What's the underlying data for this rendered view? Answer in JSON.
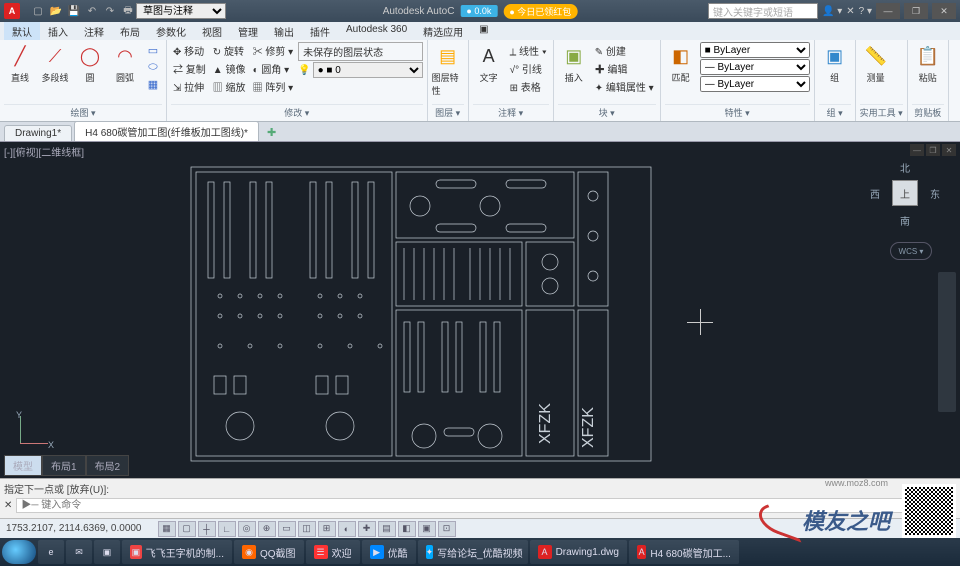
{
  "titlebar": {
    "app": "Autodesk AutoC",
    "workspace": "草图与注释",
    "badge1": "● 0.0k",
    "badge2": "● 今日已领红包",
    "search_placeholder": "键入关键字或短语",
    "minimize": "—",
    "maximize": "❐",
    "close": "✕",
    "logo": "A"
  },
  "menu": [
    "默认",
    "插入",
    "注释",
    "布局",
    "参数化",
    "视图",
    "管理",
    "输出",
    "插件",
    "Autodesk 360",
    "精选应用",
    "▣"
  ],
  "ribbon": {
    "draw": {
      "title": "绘图 ▾",
      "line": "直线",
      "pline": "多段线",
      "circle": "圆",
      "arc": "圆弧"
    },
    "modify": {
      "title": "修改 ▾",
      "items": [
        "✥ 移动",
        "↻ 旋转",
        "✂ 修剪 ▾",
        "⇄ 复制",
        "▲ 镜像",
        "◐ 圆角 ▾",
        "⇲ 拉伸",
        "▥ 缩放",
        "▦ 阵列 ▾"
      ],
      "restore": "未保存的图层状态"
    },
    "layer": {
      "title": "图层 ▾",
      "btn": "图层特性",
      "sel": "● ■ 0"
    },
    "annot": {
      "title": "注释 ▾",
      "text": "文字",
      "items": [
        "⟂ 线性 ▾",
        "√° 引线",
        "⊞ 表格"
      ]
    },
    "block": {
      "title": "块 ▾",
      "insert": "插入",
      "items": [
        "✎ 创建",
        "✚ 编辑",
        "✦ 编辑属性 ▾"
      ]
    },
    "prop": {
      "title": "特性 ▾",
      "color": "■ ByLayer",
      "lw": "— ByLayer",
      "lt": "— ByLayer",
      "match": "匹配"
    },
    "group": {
      "title": "组 ▾",
      "btn": "组"
    },
    "util": {
      "title": "实用工具 ▾",
      "btn": "测量",
      "paste": "粘贴"
    },
    "clip": {
      "title": "剪贴板",
      "btn": "粘贴"
    }
  },
  "doc_tabs": [
    "Drawing1*",
    "H4 680碳管加工图(纤维板加工图线)*"
  ],
  "canvas": {
    "view": "[-][俯视][二维线框]",
    "cube": "上",
    "dirs": {
      "n": "北",
      "s": "南",
      "e": "东",
      "w": "西"
    },
    "wheel": "WCS ▾"
  },
  "drawing_text": {
    "a": "XFZK",
    "b": "XFZK"
  },
  "layout_tabs": [
    "模型",
    "布局1",
    "布局2"
  ],
  "cmd": {
    "history": "指定下一点或 [放弃(U)]:",
    "prompt": "▶─ 键入命令",
    "hx": "✕"
  },
  "status": {
    "coords": "1753.2107, 2114.6369, 0.0000",
    "toggles": [
      "▦",
      "▢",
      "┼",
      "∟",
      "◎",
      "⊕",
      "▭",
      "◫",
      "⊞",
      "◐",
      "✚",
      "▤",
      "◧",
      "▣",
      "⊡"
    ]
  },
  "taskbar": {
    "pins": [
      {
        "c": "#3cf",
        "t": "e"
      },
      {
        "c": "#fc3",
        "t": "✉"
      },
      {
        "c": "#6c6",
        "t": "▣"
      }
    ],
    "tasks": [
      {
        "c": "#e44",
        "t": "▣",
        "l": "飞飞王字机的制..."
      },
      {
        "c": "#f60",
        "t": "◉",
        "l": "QQ截图"
      },
      {
        "c": "#f33",
        "t": "☰",
        "l": "欢迎"
      },
      {
        "c": "#08f",
        "t": "▶",
        "l": "优酷"
      },
      {
        "c": "#0af",
        "t": "✦",
        "l": "写给论坛_优酷视频"
      },
      {
        "c": "#d22",
        "t": "A",
        "l": "Drawing1.dwg"
      },
      {
        "c": "#d22",
        "t": "A",
        "l": "H4 680碳管加工..."
      }
    ]
  },
  "footer": "模友之吧",
  "watermark": "www.moz8.com"
}
